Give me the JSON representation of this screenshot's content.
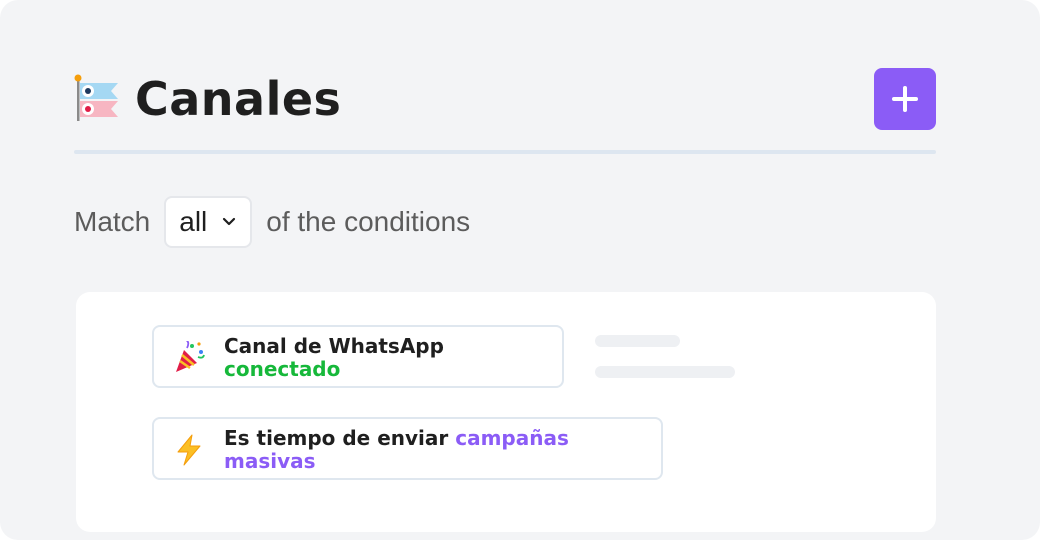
{
  "header": {
    "title": "Canales",
    "add_label": "+"
  },
  "filter": {
    "prefix": "Match",
    "selected": "all",
    "suffix": "of the conditions"
  },
  "conditions": [
    {
      "icon": "party-popper-icon",
      "line1": "Canal de WhatsApp",
      "line2": "conectado"
    },
    {
      "icon": "lightning-icon",
      "text": "Es tiempo de enviar ",
      "highlight_1": "campañas",
      "highlight_2": "masivas"
    }
  ],
  "colors": {
    "accent": "#8b5cf6",
    "success": "#16b83a",
    "panel": "#f3f4f6"
  }
}
